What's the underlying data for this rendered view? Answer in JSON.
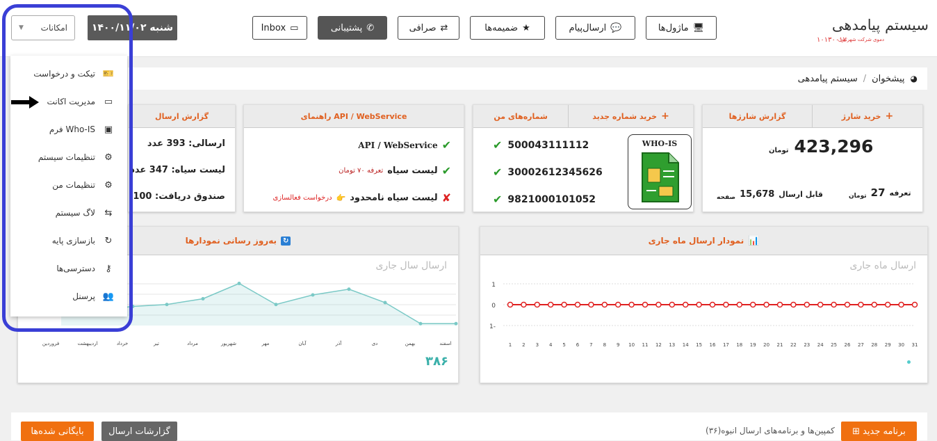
{
  "header": {
    "brand_title": "سیستم پیامدهی",
    "brand_sub": "دموی شرکت شهرتیون",
    "brand_num": "۱۰۱۳۰۰۱۷",
    "buttons": {
      "modules": "ماژول‌ها",
      "send": "ارسال‌پیام",
      "attachments": "ضمیمه‌ها",
      "exchange": "صرافی",
      "support": "پشتیبانی",
      "inbox": "Inbox"
    },
    "date": "شنبه ۱۴۰۰/۱۱/۰۲",
    "select_value": "امکانات"
  },
  "breadcrumb": {
    "home": "پیشخوان",
    "sep": "/",
    "current": "سیستم پیامدهی"
  },
  "sidebar": {
    "items": [
      {
        "label": "تیکت و درخواست",
        "icon": "ticket-icon"
      },
      {
        "label": "مدیریت اکانت",
        "icon": "credit-card-icon"
      },
      {
        "label": "فرم Who-IS",
        "icon": "save-icon"
      },
      {
        "label": "تنظیمات سیستم",
        "icon": "cogs-icon"
      },
      {
        "label": "تنظیمات من",
        "icon": "cog-icon"
      },
      {
        "label": "لاگ سیستم",
        "icon": "retweet-icon"
      },
      {
        "label": "بازسازی پایه",
        "icon": "refresh-icon"
      },
      {
        "label": "دسترسی‌ها",
        "icon": "key-icon"
      },
      {
        "label": "پرسنل",
        "icon": "users-icon"
      }
    ]
  },
  "cards": {
    "charge": {
      "buy": "خرید شارژ",
      "report": "گزارش شارژها",
      "balance": "423,296",
      "unit": "تومان",
      "tariff_label": "تعرفه",
      "tariff": "27",
      "tariff_unit": "تومان",
      "sendable_label": "قابل ارسال",
      "sendable": "15,678",
      "sendable_unit": "صفحه"
    },
    "numbers": {
      "buy": "خرید شماره جدید",
      "mine": "شماره‌های من",
      "who_is": "WHO-IS",
      "list": [
        "500043111112",
        "30002612345626",
        "9821000101052"
      ]
    },
    "api": {
      "title": "API / WebService راهنمای",
      "r1": "API / WebService",
      "r2": "لیست سیاه",
      "r2_extra": "تعرفه ۷۰ تومان",
      "r3": "لیست سیاه نامحدود",
      "r3_extra": "درخواست فعالسازی"
    },
    "report": {
      "title": "گزارش ارسال",
      "r1": "ارسالی: 393 عدد",
      "r2": "لیست سیاه: 347 عدد",
      "r3": "صندوق دریافت: 100"
    }
  },
  "charts": {
    "month": {
      "header": "نمودار ارسال ماه جاری",
      "title": "ارسال ماه جاری"
    },
    "year": {
      "header": "به‌روز رسانی نمودارها",
      "title": "ارسال سال جاری",
      "total": "۳۸۶"
    }
  },
  "bottom": {
    "new_program": "برنامه جدید",
    "campaigns": "کمپین‌ها و برنامه‌های ارسال انبوه(۳۶)",
    "reports": "گزارشات ارسال",
    "archive": "بایگانی شده‌ها"
  },
  "chart_data": [
    {
      "type": "line",
      "title": "ارسال ماه جاری",
      "x": [
        "1",
        "2",
        "3",
        "4",
        "5",
        "6",
        "7",
        "8",
        "9",
        "10",
        "11",
        "12",
        "13",
        "14",
        "15",
        "16",
        "17",
        "18",
        "19",
        "20",
        "21",
        "22",
        "23",
        "24",
        "25",
        "26",
        "27",
        "28",
        "29",
        "30",
        "31"
      ],
      "series": [
        {
          "values": [
            0,
            0,
            0,
            0,
            0,
            0,
            0,
            0,
            0,
            0,
            0,
            0,
            0,
            0,
            0,
            0,
            0,
            0,
            0,
            0,
            0,
            0,
            0,
            0,
            0,
            0,
            0,
            0,
            0,
            0,
            0
          ]
        }
      ],
      "ylim": [
        -1,
        1
      ],
      "y_ticks": [
        "1",
        "0",
        "1-"
      ],
      "color": "#e02020"
    },
    {
      "type": "area",
      "title": "ارسال سال جاری",
      "categories": [
        "فروردین",
        "اردیبهشت",
        "خرداد",
        "تیر",
        "مرداد",
        "شهریور",
        "مهر",
        "آبان",
        "آذر",
        "دی",
        "بهمن",
        "اسفند"
      ],
      "series": [
        {
          "values": [
            45,
            40,
            50,
            55,
            70,
            110,
            55,
            80,
            95,
            60,
            5,
            5
          ]
        }
      ],
      "color": "#7ac9c6"
    }
  ]
}
